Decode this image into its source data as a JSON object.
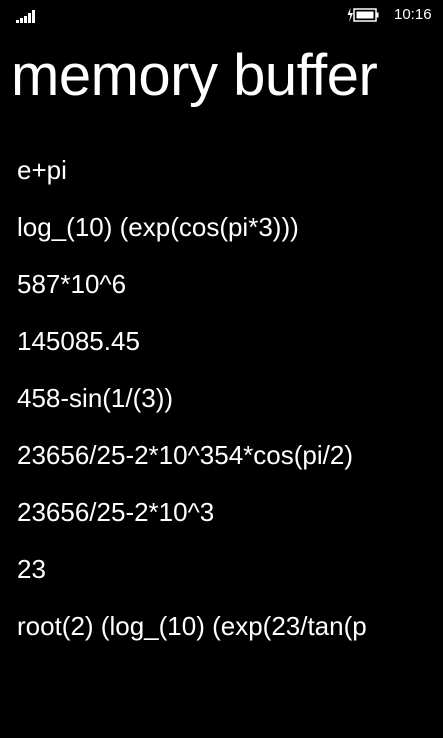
{
  "status_bar": {
    "time": "10:16",
    "signal_icon": "signal-strength-icon",
    "battery_icon": "battery-charging-icon"
  },
  "page": {
    "title": "memory buffer"
  },
  "buffer": {
    "items": [
      {
        "expression": "e+pi"
      },
      {
        "expression": "log_(10) (exp(cos(pi*3)))"
      },
      {
        "expression": "587*10^6"
      },
      {
        "expression": "145085.45"
      },
      {
        "expression": "458-sin(1/(3))"
      },
      {
        "expression": "23656/25-2*10^354*cos(pi/2)"
      },
      {
        "expression": "23656/25-2*10^3"
      },
      {
        "expression": "23"
      },
      {
        "expression": "root(2) (log_(10) (exp(23/tan(p"
      }
    ]
  }
}
